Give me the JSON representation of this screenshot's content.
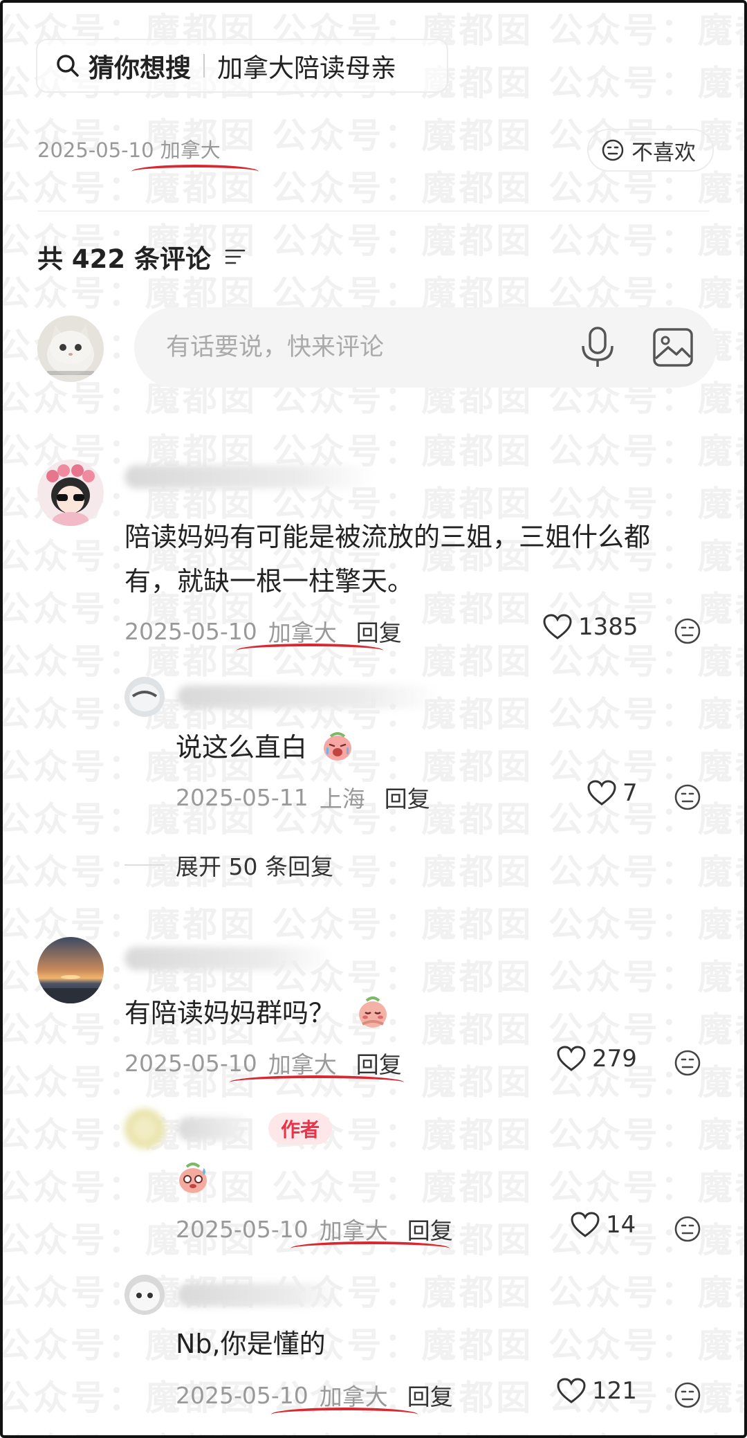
{
  "search": {
    "title": "猜你想搜",
    "query": "加拿大陪读母亲"
  },
  "post": {
    "date": "2025-05-10",
    "location": "加拿大"
  },
  "dislike": {
    "label": "不喜欢"
  },
  "comments_header": {
    "count_text": "共 422 条评论"
  },
  "input": {
    "placeholder": "有话要说，快来评论"
  },
  "watermark": "公众号：魔都囡",
  "comments": [
    {
      "text_line1": "陪读妈妈有可能是被流放的三姐，三姐什么都",
      "text_line2": "有，就缺一根一柱擎天。",
      "date": "2025-05-10",
      "location": "加拿大",
      "reply": "回复",
      "likes": "1385",
      "replies": [
        {
          "text": "说这么直白",
          "date": "2025-05-11",
          "location": "上海",
          "reply": "回复",
          "likes": "7"
        }
      ],
      "expand_text": "展开 50 条回复"
    },
    {
      "text": "有陪读妈妈群吗？",
      "date": "2025-05-10",
      "location": "加拿大",
      "reply": "回复",
      "likes": "279",
      "replies": [
        {
          "author_tag": "作者",
          "date": "2025-05-10",
          "location": "加拿大",
          "reply": "回复",
          "likes": "14"
        },
        {
          "text": "Nb,你是懂的",
          "date": "2025-05-10",
          "location": "加拿大",
          "reply": "回复",
          "likes": "121"
        }
      ]
    }
  ],
  "colors": {
    "annotation_red": "#d9262f",
    "author_tag_bg": "#fde7e9",
    "author_tag_text": "#e8334a",
    "meta_gray": "#999999"
  }
}
